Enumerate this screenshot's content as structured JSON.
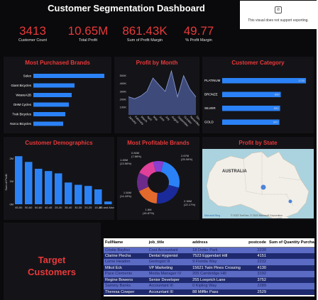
{
  "header": {
    "title": "Customer Segmentation Dashboard",
    "notice": "This visual does not support exporting."
  },
  "kpis": [
    {
      "value": "3413",
      "label": "Customer Count"
    },
    {
      "value": "10.65M",
      "label": "Total Profit"
    },
    {
      "value": "861.43K",
      "label": "Sum of Profit Margin"
    },
    {
      "value": "49.77",
      "label": "% Profit Margin"
    }
  ],
  "panels": {
    "brands": "Most Purchased Brands",
    "profit_month": "Profit by Month",
    "category": "Customer Category",
    "demographics": "Customer Demographics",
    "profitable_brands": "Most Profitable Brands",
    "state": "Profit by State",
    "target": "Target Customers"
  },
  "colors": {
    "accent": "#e8393a",
    "bar": "#2b82f6",
    "area": "#3d4a7a"
  },
  "chart_data": [
    {
      "type": "bar",
      "orientation": "horizontal",
      "categories": [
        "Solex",
        "Giant Bicycles",
        "WeareA2B",
        "OHM Cycles",
        "Trek Bicycles",
        "Norco Bicycles"
      ],
      "values": [
        100,
        58,
        54,
        50,
        45,
        42
      ]
    },
    {
      "type": "area",
      "x": [
        "January",
        "February",
        "March",
        "April",
        "May",
        "June",
        "July",
        "August",
        "September",
        "October",
        "November",
        "December"
      ],
      "values": [
        230,
        205,
        240,
        300,
        470,
        380,
        300,
        560,
        230,
        500,
        330,
        230
      ],
      "yticks": [
        "100K",
        "200K",
        "300K",
        "400K",
        "500K"
      ],
      "ylim": [
        0,
        560
      ]
    },
    {
      "type": "bar",
      "orientation": "horizontal",
      "categories": [
        "PLATINUM",
        "BRONZE",
        "SILVER",
        "GOLD"
      ],
      "values": [
        1230,
        860,
        850,
        840
      ],
      "labels": [
        "1230",
        "860",
        "850",
        "840"
      ],
      "xlim": [
        0,
        1250
      ]
    },
    {
      "type": "bar",
      "categories": [
        "45-50",
        "50-60",
        "60-80",
        "40-45",
        "25-30",
        "35-40",
        "30-35",
        "20-25",
        "15-20",
        "80 and Above"
      ],
      "values": [
        2.1,
        1.85,
        1.55,
        1.45,
        1.35,
        0.95,
        0.85,
        0.8,
        0.65,
        0.12
      ],
      "yticks": [
        "0M",
        "1M",
        "2M"
      ],
      "ylabel": "Sum of Profit",
      "ylim": [
        0,
        2.2
      ]
    },
    {
      "type": "pie",
      "donut": true,
      "slices": [
        {
          "label": "2.67M (25.08%)",
          "value": 25.08,
          "color": "#2b82f6"
        },
        {
          "label": "2.36M (22.17%)",
          "value": 22.17,
          "color": "#1a2a9a"
        },
        {
          "label": "1.8M (16.87%)",
          "value": 16.87,
          "color": "#e26a2c"
        },
        {
          "label": "1.54M (14.43%)",
          "value": 14.43,
          "color": "#6c2a8a"
        },
        {
          "label": "1.45M (13.56%)",
          "value": 13.56,
          "color": "#e0409a"
        },
        {
          "label": "0.84M (7.88%)",
          "value": 7.88,
          "color": "#8a3fd0"
        }
      ]
    }
  ],
  "map": {
    "label": "AUSTRALIA",
    "credit": "© 2023 TomTom, © 2023 Microsoft Corporation",
    "brand": "Microsoft Bing"
  },
  "table": {
    "columns": [
      "FullName",
      "job_title",
      "address",
      "postcode",
      "Sum of Quantity Purchased"
    ],
    "rows": [
      [
        "Cristie Bayliss",
        "Cost Accountant",
        "18 Dottie Park",
        "2230"
      ],
      [
        "Clarine Piecha",
        "Dental Hygienist",
        "7523 Eggendart Hill",
        "4151"
      ],
      [
        "Lorne Headon",
        "Geologist III",
        "9 Florida Way",
        "2232"
      ],
      [
        "Mikol Eck",
        "VP Marketing",
        "15621 Twin Pines Crossing",
        "4130"
      ],
      [
        "Pace Clements",
        "Media Manager IV",
        "205 Cambridge Hill",
        "3192"
      ],
      [
        "Regine Bowens",
        "Senior Developer",
        "255 Loeprich Lane",
        "3752"
      ],
      [
        "Sammy Banks",
        "Accountant III",
        "0 Kipling Way",
        "2289"
      ],
      [
        "Theresa Cowper",
        "Accountant III",
        "88 Mifflin Pass",
        "2529"
      ]
    ]
  }
}
